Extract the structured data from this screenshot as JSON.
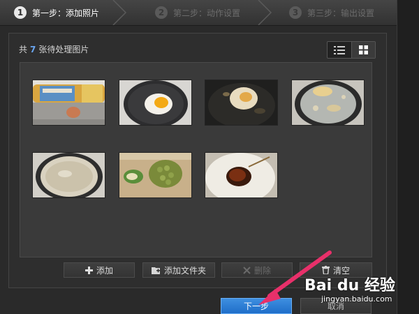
{
  "steps": [
    {
      "number": "1",
      "label": "第一步：添加照片",
      "state": "active"
    },
    {
      "number": "2",
      "label": "第二步：动作设置",
      "state": "inactive"
    },
    {
      "number": "3",
      "label": "第三步：输出设置",
      "state": "inactive"
    }
  ],
  "panel": {
    "count_prefix": "共",
    "count": "7",
    "count_suffix": "张待处理图片",
    "view_modes": [
      "list-view-icon",
      "grid-view-icon"
    ],
    "selected_view": "grid"
  },
  "thumbnails": [
    {
      "subject": "sauce bottle and egg"
    },
    {
      "subject": "fried egg in pan"
    },
    {
      "subject": "egg frying in oil"
    },
    {
      "subject": "boiling water in pot"
    },
    {
      "subject": "rice porridge in pot"
    },
    {
      "subject": "chopped scallion and peas on board"
    },
    {
      "subject": "soup bowl"
    }
  ],
  "actions": {
    "add": "添加",
    "add_folder": "添加文件夹",
    "delete": "删除",
    "clear": "清空"
  },
  "footer": {
    "next": "下一步",
    "cancel": "取消"
  },
  "watermark": {
    "logo": "Bai du 经验",
    "url": "jingyan.baidu.com"
  },
  "colors": {
    "accent": "#2f7fd8",
    "count_highlight": "#6aa6f0",
    "arrow": "#e8306a"
  }
}
